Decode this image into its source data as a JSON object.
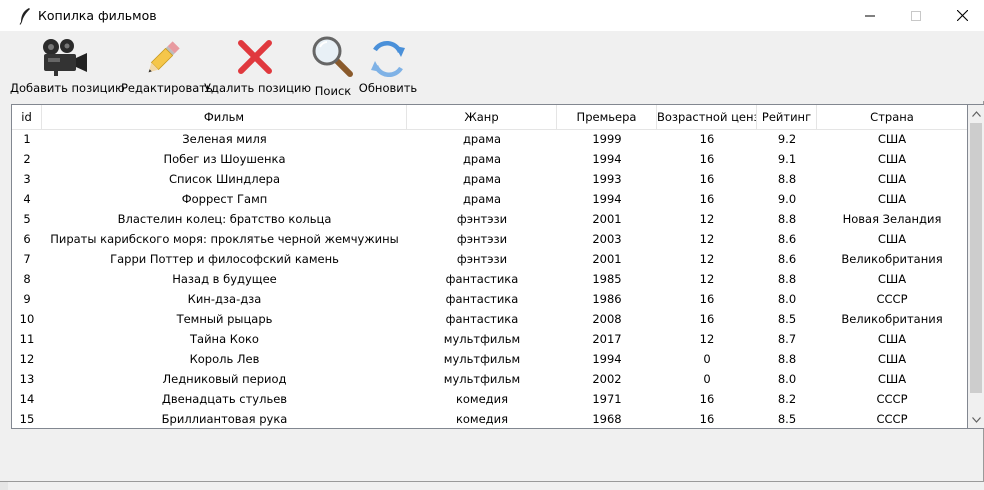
{
  "window": {
    "title": "Копилка фильмов"
  },
  "toolbar": {
    "add_label": "Добавить позицию",
    "edit_label": "Редактировать",
    "delete_label": "Удалить позицию",
    "search_label": "Поиск",
    "refresh_label": "Обновить"
  },
  "table": {
    "headers": [
      "id",
      "Фильм",
      "Жанр",
      "Премьера",
      "Возрастной ценз",
      "Рейтинг",
      "Страна"
    ],
    "rows": [
      [
        "1",
        "Зеленая миля",
        "драма",
        "1999",
        "16",
        "9.2",
        "США"
      ],
      [
        "2",
        "Побег из Шоушенка",
        "драма",
        "1994",
        "16",
        "9.1",
        "США"
      ],
      [
        "3",
        "Список Шиндлера",
        "драма",
        "1993",
        "16",
        "8.8",
        "США"
      ],
      [
        "4",
        "Форрест Гамп",
        "драма",
        "1994",
        "16",
        "9.0",
        "США"
      ],
      [
        "5",
        "Властелин колец: братство кольца",
        "фэнтэзи",
        "2001",
        "12",
        "8.8",
        "Новая Зеландия"
      ],
      [
        "6",
        "Пираты карибского моря: проклятье черной жемчужины",
        "фэнтэзи",
        "2003",
        "12",
        "8.6",
        "США"
      ],
      [
        "7",
        "Гарри Поттер и философский камень",
        "фэнтэзи",
        "2001",
        "12",
        "8.6",
        "Великобритания"
      ],
      [
        "8",
        "Назад в будущее",
        "фантастика",
        "1985",
        "12",
        "8.8",
        "США"
      ],
      [
        "9",
        "Кин-дза-дза",
        "фантастика",
        "1986",
        "16",
        "8.0",
        "СССР"
      ],
      [
        "10",
        "Темный рыцарь",
        "фантастика",
        "2008",
        "16",
        "8.5",
        "Великобритания"
      ],
      [
        "11",
        "Тайна Коко",
        "мультфильм",
        "2017",
        "12",
        "8.7",
        "США"
      ],
      [
        "12",
        "Король Лев",
        "мультфильм",
        "1994",
        "0",
        "8.8",
        "США"
      ],
      [
        "13",
        "Ледниковый период",
        "мультфильм",
        "2002",
        "0",
        "8.0",
        "США"
      ],
      [
        "14",
        "Двенадцать стульев",
        "комедия",
        "1971",
        "16",
        "8.2",
        "СССР"
      ],
      [
        "15",
        "Бриллиантовая рука",
        "комедия",
        "1968",
        "16",
        "8.5",
        "СССР"
      ]
    ]
  },
  "icons": {
    "app": "feather-icon",
    "add": "movie-camera-icon",
    "edit": "pencil-icon",
    "delete": "red-x-icon",
    "search": "magnifier-icon",
    "refresh": "refresh-arrows-icon"
  },
  "colors": {
    "delete_red": "#e0393e",
    "refresh_blue": "#4a90d9",
    "pencil_yellow": "#f5c64a"
  }
}
